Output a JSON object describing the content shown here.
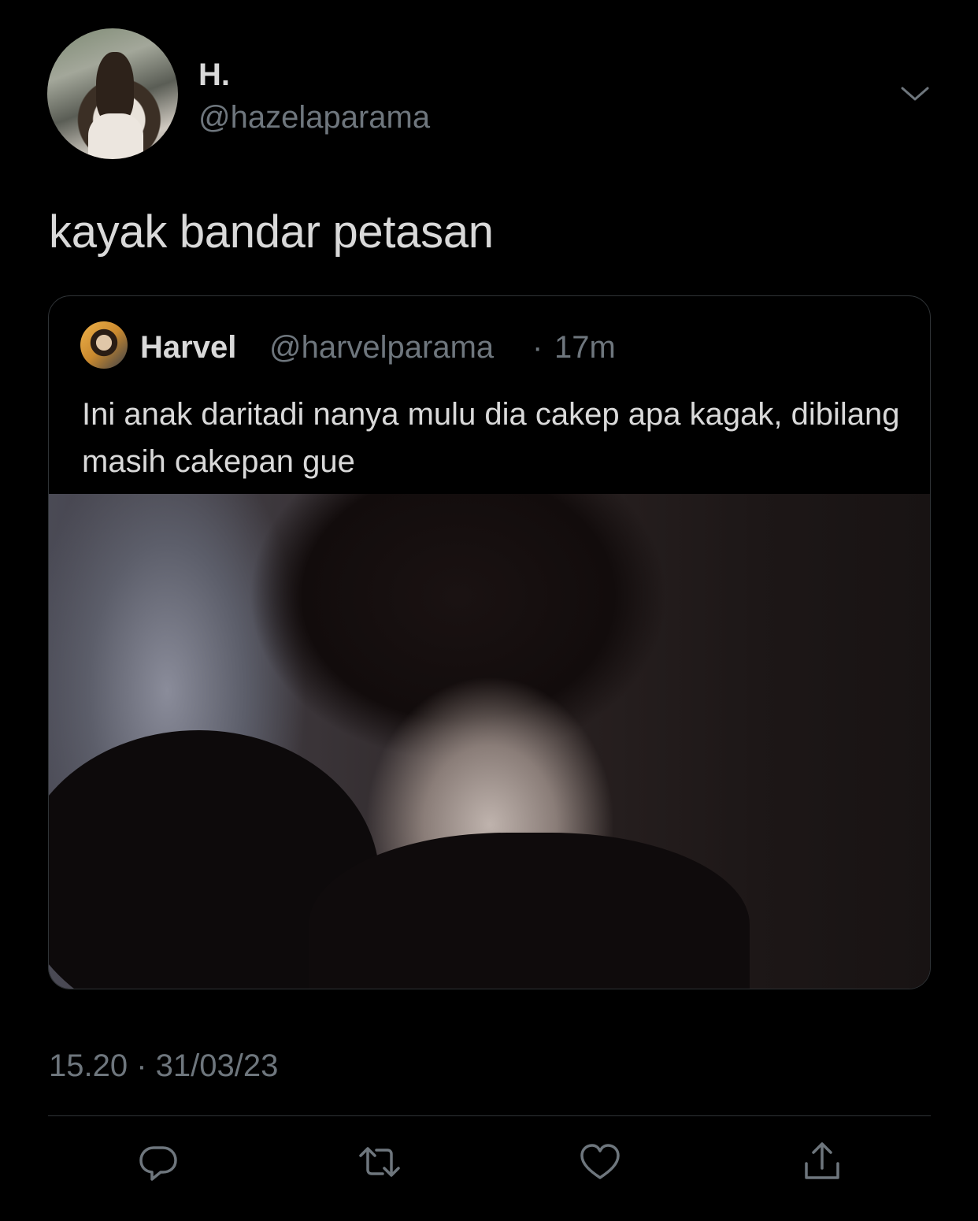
{
  "tweet": {
    "display_name": "H.",
    "handle": "@hazelaparama",
    "text": "kayak bandar petasan",
    "timestamp": "15.20 · 31/03/23"
  },
  "quoted_tweet": {
    "display_name": "Harvel",
    "handle": "@harvelparama",
    "separator": "·",
    "time": "17m",
    "text": "Ini anak daritadi nanya mulu dia cakep apa kagak, dibilang masih cakepan gue"
  },
  "actions": {
    "icons": [
      "reply-icon",
      "retweet-icon",
      "like-icon",
      "share-icon"
    ]
  },
  "colors": {
    "background": "#000000",
    "primary_text": "#d9d9d9",
    "secondary_text": "#6e767d",
    "border": "#2f3336"
  }
}
